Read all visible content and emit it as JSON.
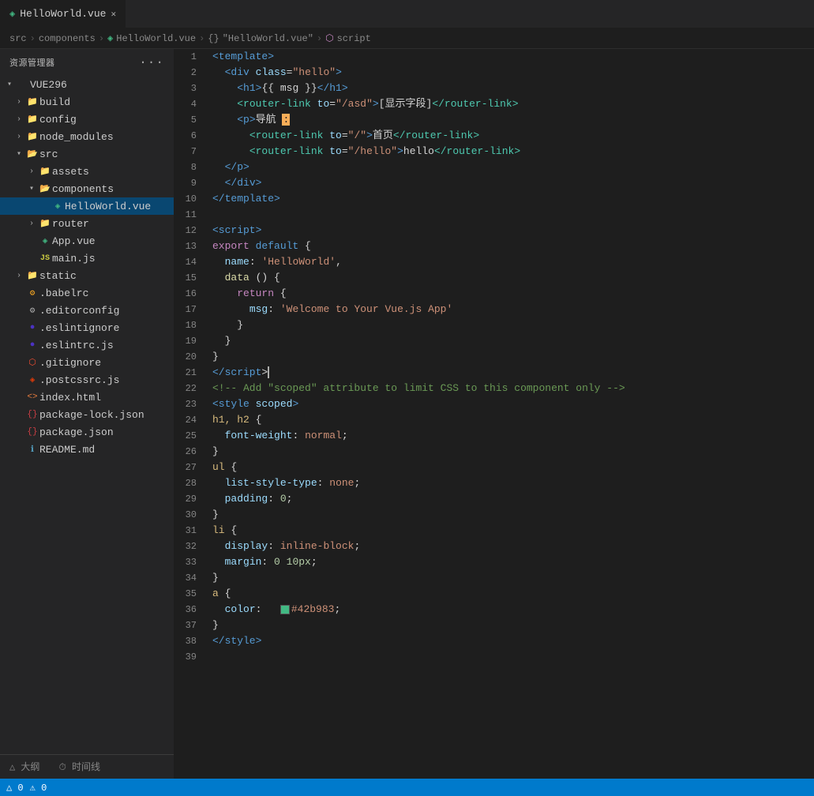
{
  "sidebar": {
    "title": "资源管理器",
    "dots": "···",
    "root": {
      "label": "VUE296",
      "expanded": true
    },
    "items": [
      {
        "id": "build",
        "label": "build",
        "type": "folder",
        "depth": 1,
        "expanded": false
      },
      {
        "id": "config",
        "label": "config",
        "type": "folder",
        "depth": 1,
        "expanded": false
      },
      {
        "id": "node_modules",
        "label": "node_modules",
        "type": "folder",
        "depth": 1,
        "expanded": false
      },
      {
        "id": "src",
        "label": "src",
        "type": "folder",
        "depth": 1,
        "expanded": true
      },
      {
        "id": "assets",
        "label": "assets",
        "type": "folder",
        "depth": 2,
        "expanded": false
      },
      {
        "id": "components",
        "label": "components",
        "type": "folder",
        "depth": 2,
        "expanded": true
      },
      {
        "id": "HelloWorld.vue",
        "label": "HelloWorld.vue",
        "type": "vue",
        "depth": 3,
        "active": true
      },
      {
        "id": "router",
        "label": "router",
        "type": "folder",
        "depth": 2,
        "expanded": false
      },
      {
        "id": "App.vue",
        "label": "App.vue",
        "type": "vue",
        "depth": 2
      },
      {
        "id": "main.js",
        "label": "main.js",
        "type": "js",
        "depth": 2
      },
      {
        "id": "static",
        "label": "static",
        "type": "folder",
        "depth": 1,
        "expanded": false
      },
      {
        "id": ".babelrc",
        "label": ".babelrc",
        "type": "babel",
        "depth": 1
      },
      {
        "id": ".editorconfig",
        "label": ".editorconfig",
        "type": "editor",
        "depth": 1
      },
      {
        "id": ".eslintignore",
        "label": ".eslintignore",
        "type": "eslint",
        "depth": 1
      },
      {
        "id": ".eslintrc.js",
        "label": ".eslintrc.js",
        "type": "eslint2",
        "depth": 1
      },
      {
        "id": ".gitignore",
        "label": ".gitignore",
        "type": "git",
        "depth": 1
      },
      {
        "id": ".postcssrc.js",
        "label": ".postcssrc.js",
        "type": "postcss",
        "depth": 1
      },
      {
        "id": "index.html",
        "label": "index.html",
        "type": "html",
        "depth": 1
      },
      {
        "id": "package-lock.json",
        "label": "package-lock.json",
        "type": "json",
        "depth": 1
      },
      {
        "id": "package.json",
        "label": "package.json",
        "type": "json",
        "depth": 1
      },
      {
        "id": "README.md",
        "label": "README.md",
        "type": "readme",
        "depth": 1
      }
    ],
    "bottom_tabs": [
      {
        "label": "△ 大纲"
      },
      {
        "label": "⏱ 时间线"
      }
    ]
  },
  "tab": {
    "filename": "HelloWorld.vue",
    "icon": "vue"
  },
  "breadcrumb": {
    "parts": [
      "src",
      ">",
      "components",
      ">",
      "HelloWorld.vue",
      ">",
      "{}",
      "\"HelloWorld.vue\"",
      ">",
      "script"
    ]
  },
  "status": {
    "left": [
      "△ 0",
      "⚠ 0"
    ],
    "right": []
  },
  "editor": {
    "lines": [
      {
        "num": 1,
        "tokens": [
          {
            "t": "c-tag",
            "v": "<template>"
          }
        ]
      },
      {
        "num": 2,
        "tokens": [
          {
            "t": "c-text",
            "v": "  "
          },
          {
            "t": "c-tag",
            "v": "<div"
          },
          {
            "t": "c-text",
            "v": " "
          },
          {
            "t": "c-attr",
            "v": "class"
          },
          {
            "t": "c-op",
            "v": "="
          },
          {
            "t": "c-val",
            "v": "\"hello\""
          },
          {
            "t": "c-tag",
            "v": ">"
          }
        ]
      },
      {
        "num": 3,
        "tokens": [
          {
            "t": "c-text",
            "v": "    "
          },
          {
            "t": "c-tag",
            "v": "<h1>"
          },
          {
            "t": "c-text",
            "v": "{{ msg }}"
          },
          {
            "t": "c-tag",
            "v": "</h1>"
          }
        ]
      },
      {
        "num": 4,
        "tokens": [
          {
            "t": "c-text",
            "v": "    "
          },
          {
            "t": "c-router",
            "v": "<router-link"
          },
          {
            "t": "c-text",
            "v": " "
          },
          {
            "t": "c-attr",
            "v": "to"
          },
          {
            "t": "c-op",
            "v": "="
          },
          {
            "t": "c-val",
            "v": "\"/asd\""
          },
          {
            "t": "c-tag",
            "v": ">"
          },
          {
            "t": "c-text",
            "v": "[显示字段]"
          },
          {
            "t": "c-router",
            "v": "</router-link>"
          }
        ]
      },
      {
        "num": 5,
        "tokens": [
          {
            "t": "c-text",
            "v": "    "
          },
          {
            "t": "c-tag",
            "v": "<p>"
          },
          {
            "t": "c-text",
            "v": "导航 "
          },
          {
            "t": "highlight",
            "v": ":"
          }
        ]
      },
      {
        "num": 6,
        "tokens": [
          {
            "t": "c-text",
            "v": "      "
          },
          {
            "t": "c-router",
            "v": "<router-link"
          },
          {
            "t": "c-text",
            "v": " "
          },
          {
            "t": "c-attr",
            "v": "to"
          },
          {
            "t": "c-op",
            "v": "="
          },
          {
            "t": "c-val",
            "v": "\"/\""
          },
          {
            "t": "c-tag",
            "v": ">"
          },
          {
            "t": "c-text",
            "v": "首页"
          },
          {
            "t": "c-router",
            "v": "</router-link>"
          }
        ]
      },
      {
        "num": 7,
        "tokens": [
          {
            "t": "c-text",
            "v": "      "
          },
          {
            "t": "c-router",
            "v": "<router-link"
          },
          {
            "t": "c-text",
            "v": " "
          },
          {
            "t": "c-attr",
            "v": "to"
          },
          {
            "t": "c-op",
            "v": "="
          },
          {
            "t": "c-val",
            "v": "\"/hello\""
          },
          {
            "t": "c-tag",
            "v": ">"
          },
          {
            "t": "c-text",
            "v": "hello"
          },
          {
            "t": "c-router",
            "v": "</router-link>"
          }
        ]
      },
      {
        "num": 8,
        "tokens": [
          {
            "t": "c-text",
            "v": "  "
          },
          {
            "t": "c-tag",
            "v": "</p>"
          }
        ]
      },
      {
        "num": 9,
        "tokens": [
          {
            "t": "c-text",
            "v": "  "
          },
          {
            "t": "c-tag",
            "v": "</div>"
          }
        ]
      },
      {
        "num": 10,
        "tokens": [
          {
            "t": "c-tag",
            "v": "</template>"
          }
        ]
      },
      {
        "num": 11,
        "tokens": []
      },
      {
        "num": 12,
        "tokens": [
          {
            "t": "c-tag",
            "v": "<script>"
          }
        ]
      },
      {
        "num": 13,
        "tokens": [
          {
            "t": "c-export",
            "v": "export"
          },
          {
            "t": "c-text",
            "v": " "
          },
          {
            "t": "c-default",
            "v": "default"
          },
          {
            "t": "c-text",
            "v": " {"
          }
        ]
      },
      {
        "num": 14,
        "tokens": [
          {
            "t": "c-text",
            "v": "  "
          },
          {
            "t": "c-prop",
            "v": "name"
          },
          {
            "t": "c-op",
            "v": ":"
          },
          {
            "t": "c-text",
            "v": " "
          },
          {
            "t": "c-str",
            "v": "'HelloWorld'"
          },
          {
            "t": "c-text",
            "v": ","
          }
        ]
      },
      {
        "num": 15,
        "tokens": [
          {
            "t": "c-text",
            "v": "  "
          },
          {
            "t": "c-data",
            "v": "data"
          },
          {
            "t": "c-text",
            "v": " () {"
          }
        ]
      },
      {
        "num": 16,
        "tokens": [
          {
            "t": "c-text",
            "v": "    "
          },
          {
            "t": "c-return",
            "v": "return"
          },
          {
            "t": "c-text",
            "v": " {"
          }
        ]
      },
      {
        "num": 17,
        "tokens": [
          {
            "t": "c-text",
            "v": "      "
          },
          {
            "t": "c-msg-key",
            "v": "msg"
          },
          {
            "t": "c-op",
            "v": ":"
          },
          {
            "t": "c-text",
            "v": " "
          },
          {
            "t": "c-msg-val",
            "v": "'Welcome to Your Vue.js App'"
          }
        ]
      },
      {
        "num": 18,
        "tokens": [
          {
            "t": "c-text",
            "v": "    }"
          }
        ]
      },
      {
        "num": 19,
        "tokens": [
          {
            "t": "c-text",
            "v": "  }"
          }
        ]
      },
      {
        "num": 20,
        "tokens": [
          {
            "t": "c-text",
            "v": "}"
          }
        ]
      },
      {
        "num": 21,
        "tokens": [
          {
            "t": "c-tag",
            "v": "</script"
          },
          {
            "t": "c-text",
            "v": ">"
          },
          {
            "t": "cursor",
            "v": ""
          }
        ]
      },
      {
        "num": 22,
        "tokens": [
          {
            "t": "c-comment",
            "v": "<!-- Add \"scoped\" attribute to limit CSS to this component only -->"
          }
        ]
      },
      {
        "num": 23,
        "tokens": [
          {
            "t": "c-tag",
            "v": "<style"
          },
          {
            "t": "c-text",
            "v": " "
          },
          {
            "t": "c-attr",
            "v": "scoped"
          },
          {
            "t": "c-tag",
            "v": ">"
          }
        ]
      },
      {
        "num": 24,
        "tokens": [
          {
            "t": "c-css-sel",
            "v": "h1, h2"
          },
          {
            "t": "c-text",
            "v": " {"
          }
        ]
      },
      {
        "num": 25,
        "tokens": [
          {
            "t": "c-text",
            "v": "  "
          },
          {
            "t": "c-css-prop",
            "v": "font-weight"
          },
          {
            "t": "c-op",
            "v": ":"
          },
          {
            "t": "c-text",
            "v": " "
          },
          {
            "t": "c-css-val",
            "v": "normal"
          },
          {
            "t": "c-op",
            "v": ";"
          }
        ]
      },
      {
        "num": 26,
        "tokens": [
          {
            "t": "c-text",
            "v": "}"
          }
        ]
      },
      {
        "num": 27,
        "tokens": [
          {
            "t": "c-css-sel",
            "v": "ul"
          },
          {
            "t": "c-text",
            "v": " {"
          }
        ]
      },
      {
        "num": 28,
        "tokens": [
          {
            "t": "c-text",
            "v": "  "
          },
          {
            "t": "c-css-prop",
            "v": "list-style-type"
          },
          {
            "t": "c-op",
            "v": ":"
          },
          {
            "t": "c-text",
            "v": " "
          },
          {
            "t": "c-css-val",
            "v": "none"
          },
          {
            "t": "c-op",
            "v": ";"
          }
        ]
      },
      {
        "num": 29,
        "tokens": [
          {
            "t": "c-text",
            "v": "  "
          },
          {
            "t": "c-css-prop",
            "v": "padding"
          },
          {
            "t": "c-op",
            "v": ":"
          },
          {
            "t": "c-text",
            "v": " "
          },
          {
            "t": "c-css-num",
            "v": "0"
          },
          {
            "t": "c-op",
            "v": ";"
          }
        ]
      },
      {
        "num": 30,
        "tokens": [
          {
            "t": "c-text",
            "v": "}"
          }
        ]
      },
      {
        "num": 31,
        "tokens": [
          {
            "t": "c-css-sel",
            "v": "li"
          },
          {
            "t": "c-text",
            "v": " {"
          }
        ]
      },
      {
        "num": 32,
        "tokens": [
          {
            "t": "c-text",
            "v": "  "
          },
          {
            "t": "c-css-prop",
            "v": "display"
          },
          {
            "t": "c-op",
            "v": ":"
          },
          {
            "t": "c-text",
            "v": " "
          },
          {
            "t": "c-css-val",
            "v": "inline-block"
          },
          {
            "t": "c-op",
            "v": ";"
          }
        ]
      },
      {
        "num": 33,
        "tokens": [
          {
            "t": "c-text",
            "v": "  "
          },
          {
            "t": "c-css-prop",
            "v": "margin"
          },
          {
            "t": "c-op",
            "v": ":"
          },
          {
            "t": "c-text",
            "v": " "
          },
          {
            "t": "c-css-num",
            "v": "0 10px"
          },
          {
            "t": "c-op",
            "v": ";"
          }
        ]
      },
      {
        "num": 34,
        "tokens": [
          {
            "t": "c-text",
            "v": "}"
          }
        ]
      },
      {
        "num": 35,
        "tokens": [
          {
            "t": "c-css-sel",
            "v": "a"
          },
          {
            "t": "c-text",
            "v": " {"
          }
        ]
      },
      {
        "num": 36,
        "tokens": [
          {
            "t": "c-text",
            "v": "  "
          },
          {
            "t": "c-css-prop",
            "v": "color"
          },
          {
            "t": "c-op",
            "v": ":"
          },
          {
            "t": "c-text",
            "v": " "
          },
          {
            "t": "swatch",
            "v": ""
          },
          {
            "t": "c-css-color",
            "v": "#42b983"
          },
          {
            "t": "c-op",
            "v": ";"
          }
        ]
      },
      {
        "num": 37,
        "tokens": [
          {
            "t": "c-text",
            "v": "}"
          }
        ]
      },
      {
        "num": 38,
        "tokens": [
          {
            "t": "c-tag",
            "v": "</style>"
          }
        ]
      },
      {
        "num": 39,
        "tokens": []
      }
    ]
  }
}
